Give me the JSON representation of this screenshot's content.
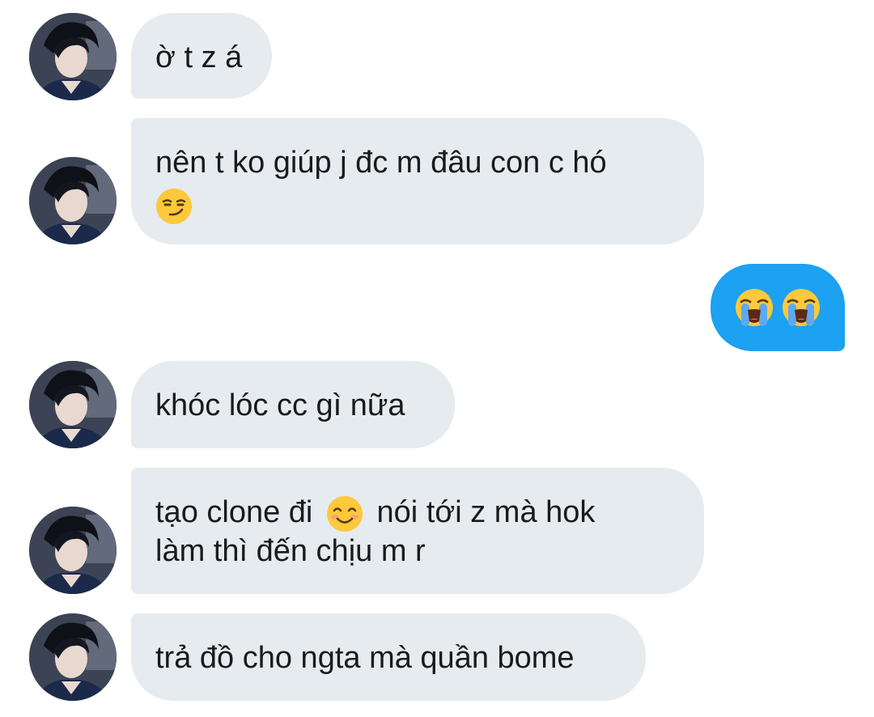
{
  "messages": [
    {
      "sender": "them",
      "text": "ờ t z á"
    },
    {
      "sender": "them",
      "text": "nên t ko giúp j đc m đâu con c hó",
      "emoji": "smirking-face"
    },
    {
      "sender": "me",
      "emojis": [
        "loudly-crying-face",
        "loudly-crying-face"
      ]
    },
    {
      "sender": "them",
      "text": "khóc lóc cc gì nữa"
    },
    {
      "sender": "them",
      "line1_a": "tạo clone đi",
      "line1_emoji": "smiling-face-with-smiling-eyes",
      "line1_b": "nói tới z mà hok",
      "line2": "làm thì đến chịu m r"
    },
    {
      "sender": "them",
      "text": "trả đồ cho ngta mà quần bome"
    }
  ],
  "colors": {
    "incoming_bubble": "#e6ebf0",
    "outgoing_bubble": "#1da1f2",
    "text": "#1a1a1a"
  }
}
